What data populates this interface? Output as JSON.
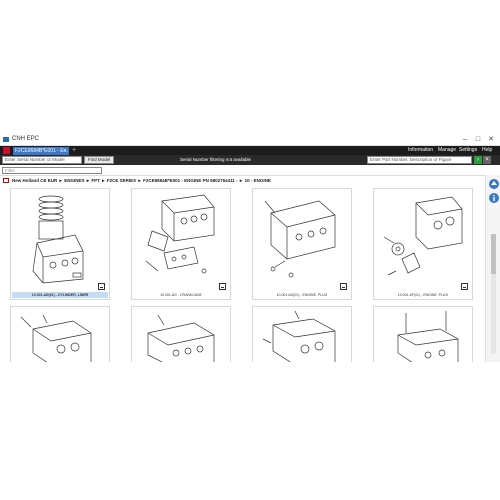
{
  "window": {
    "title": "CNH EPC",
    "minimize": "–",
    "maximize": "□",
    "close": "✕"
  },
  "tabbar": {
    "home_icon": "home-icon",
    "tab_label": "F2CE9684B*E001 - E...",
    "tab_close": "✕",
    "add_tab": "+",
    "nav": [
      "Information",
      "Manage",
      "Settings",
      "Help"
    ]
  },
  "searchbar": {
    "serial_placeholder": "Enter Serial Number or Model",
    "find_model_label": "Find Model",
    "filter_message": "Serial Number filtering not available",
    "part_placeholder": "Enter Part Number, Description or Figure",
    "go_icon": "arrow-right-icon",
    "clear_icon": "close-icon"
  },
  "filter": {
    "placeholder": "Filter"
  },
  "breadcrumb": {
    "text": "New Holland CE EUR ► ENGINES ► FPT ► F2CE SERIES ► F2CE9684B*E001 - ENGINE PN 5802764411 - ► 10 - ENGINE"
  },
  "cards": [
    {
      "caption": "10.001.AD(01) - CYLINDER, LINER",
      "selected": true
    },
    {
      "caption": "10.001.AG - CRANKCASE",
      "selected": false
    },
    {
      "caption": "10.001.AD(01) - ENGINE, PLUG",
      "selected": false
    },
    {
      "caption": "10.001.AF(01) - ENGINE, PLUG",
      "selected": false
    },
    {
      "caption": "",
      "selected": false
    },
    {
      "caption": "",
      "selected": false
    },
    {
      "caption": "",
      "selected": false
    },
    {
      "caption": "",
      "selected": false
    }
  ],
  "sidebar": {
    "icons": [
      "up-arrow-icon",
      "info-icon"
    ]
  },
  "colors": {
    "tab_active": "#3c78c3",
    "brand_red": "#c8102e",
    "dark_bar": "#1c1c1c",
    "go_green": "#2e9b3e"
  }
}
